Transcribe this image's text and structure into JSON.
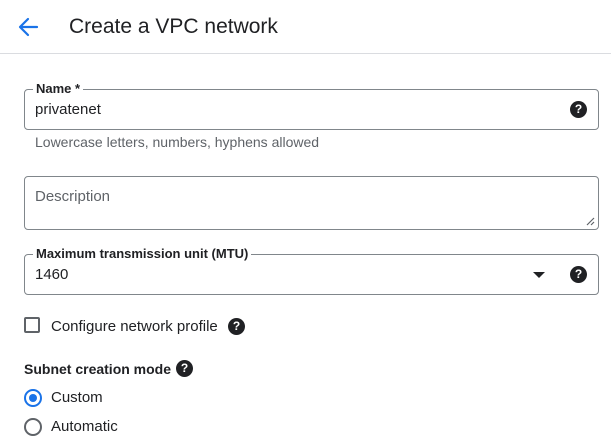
{
  "header": {
    "title": "Create a VPC network",
    "back_icon": "arrow-left-icon"
  },
  "colors": {
    "accent": "#1a73e8",
    "text": "#202124",
    "secondary_text": "#5f6368",
    "border": "#80868b",
    "divider": "#dadce0"
  },
  "name_field": {
    "label": "Name *",
    "value": "privatenet",
    "hint": "Lowercase letters, numbers, hyphens allowed",
    "help_icon": "help-icon"
  },
  "description_field": {
    "placeholder": "Description"
  },
  "mtu_field": {
    "label": "Maximum transmission unit (MTU)",
    "selected_value": "1460",
    "help_icon": "help-icon"
  },
  "network_profile": {
    "label": "Configure network profile",
    "checked": false
  },
  "subnet_creation_mode": {
    "title": "Subnet creation mode",
    "options": [
      {
        "label": "Custom",
        "selected": true
      },
      {
        "label": "Automatic",
        "selected": false
      }
    ]
  },
  "help_glyph": "?"
}
